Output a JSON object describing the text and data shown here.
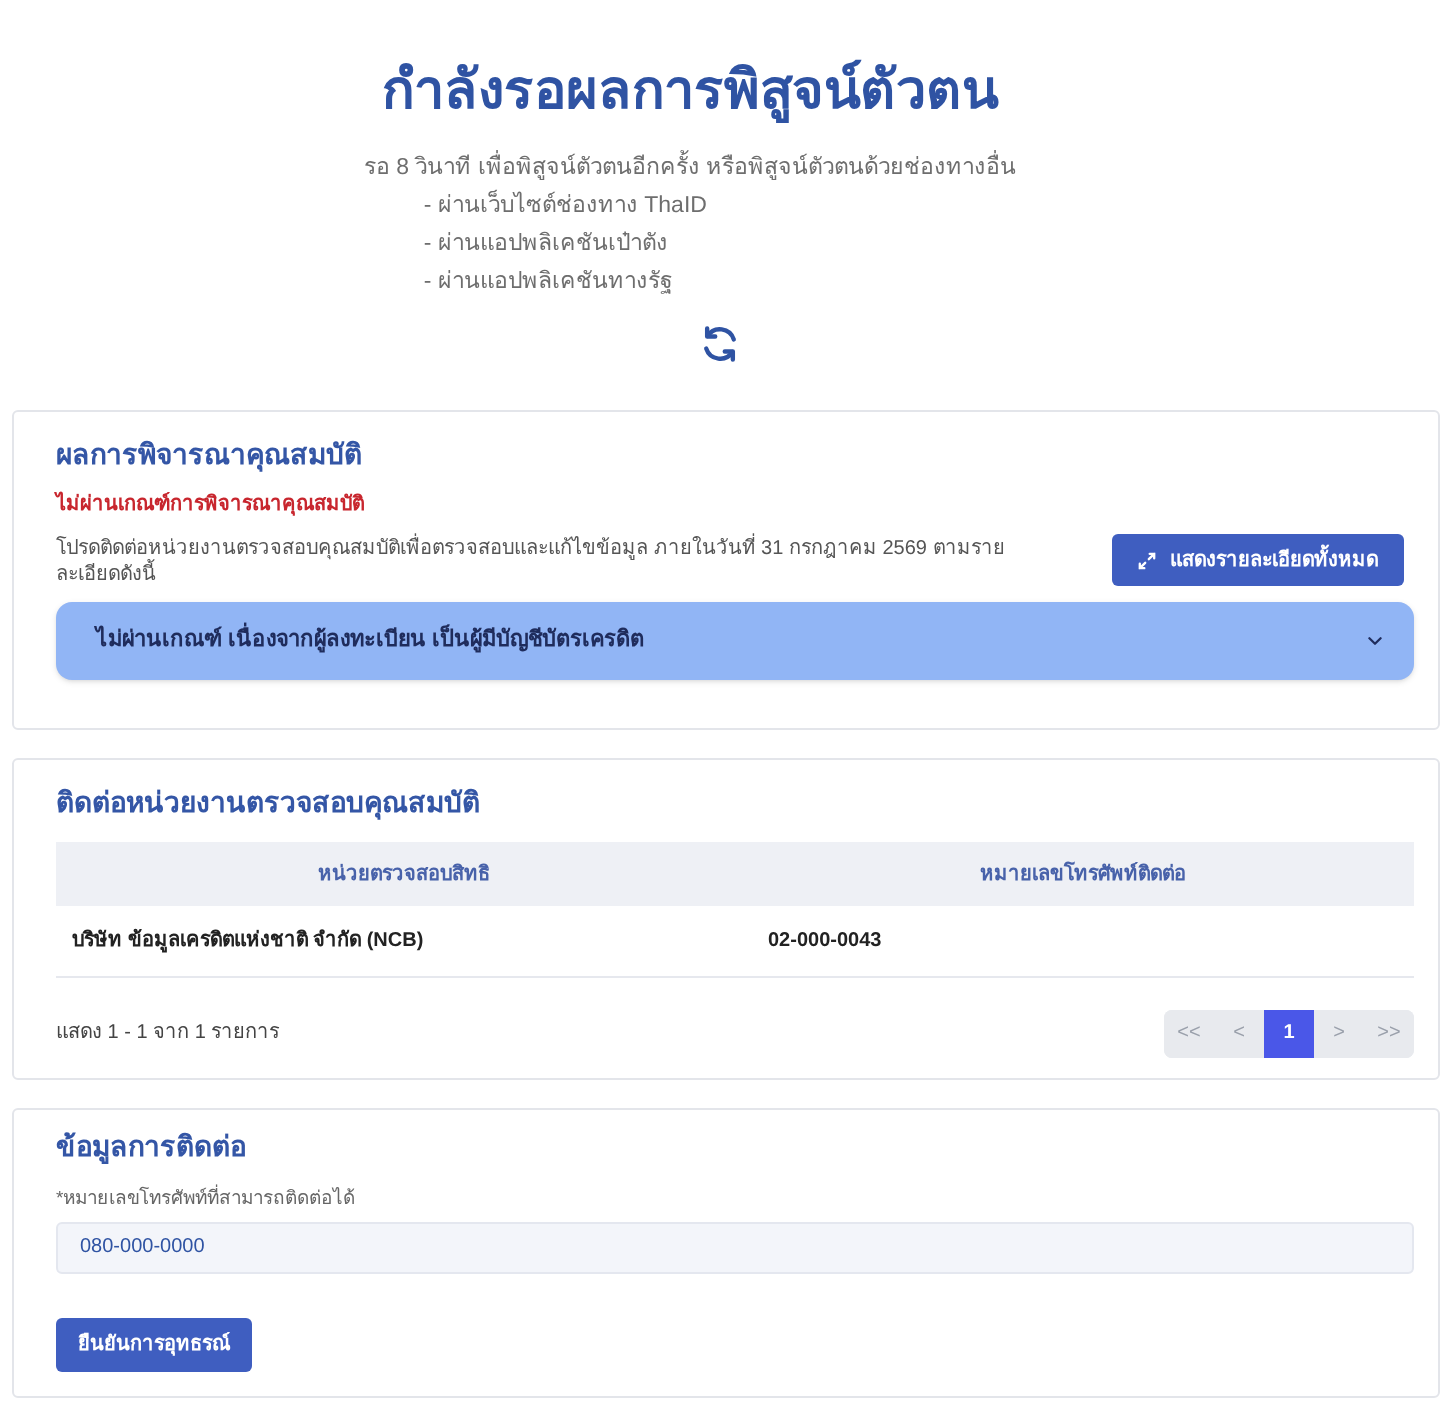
{
  "header": {
    "title": "กำลังรอผลการพิสูจน์ตัวตน",
    "message": "รอ 8 วินาที เพื่อพิสูจน์ตัวตนอีกครั้ง หรือพิสูจน์ตัวตนด้วยช่องทางอื่น",
    "channels": [
      "- ผ่านเว็บไซต์ช่องทาง ThaID",
      "- ผ่านแอปพลิเคชันเป๋าตัง",
      "- ผ่านแอปพลิเคชันทางรัฐ"
    ]
  },
  "eligibility": {
    "title": "ผลการพิจารณาคุณสมบัติ",
    "status": "ไม่ผ่านเกณฑ์การพิจารณาคุณสมบัติ",
    "description": "โปรดติดต่อหน่วยงานตรวจสอบคุณสมบัติเพื่อตรวจสอบและแก้ไขข้อมูล ภายในวันที่ 31 กรกฎาคม 2569 ตามรายละเอียดดังนี้",
    "details_button": "แสดงรายละเอียดทั้งหมด",
    "reasons": [
      {
        "label": "ไม่ผ่านเกณฑ์ เนื่องจากผู้ลงทะเบียน เป็นผู้มีบัญชีบัตรเครดิต",
        "expanded": false
      }
    ]
  },
  "contact_unit": {
    "title": "ติดต่อหน่วยงานตรวจสอบคุณสมบัติ",
    "table": {
      "columns": [
        "หน่วยตรวจสอบสิทธิ",
        "หมายเลขโทรศัพท์ติดต่อ"
      ],
      "rows": [
        [
          "บริษัท ข้อมูลเครดิตแห่งชาติ จำกัด (NCB)",
          "02-000-0043"
        ]
      ]
    },
    "summary": "แสดง 1 - 1 จาก 1 รายการ",
    "pagination": [
      {
        "label": "<<",
        "selected": false
      },
      {
        "label": "<",
        "selected": false
      },
      {
        "label": "1",
        "selected": true
      },
      {
        "label": ">",
        "selected": false
      },
      {
        "label": ">>",
        "selected": false
      }
    ]
  },
  "contact_info": {
    "title": "ข้อมูลการติดต่อ",
    "phone_field": {
      "label": "*หมายเลขโทรศัพท์ที่สามารถติดต่อได้",
      "value": "080-000-0000"
    },
    "submit_button": "ยืนยันการอุทธรณ์"
  }
}
